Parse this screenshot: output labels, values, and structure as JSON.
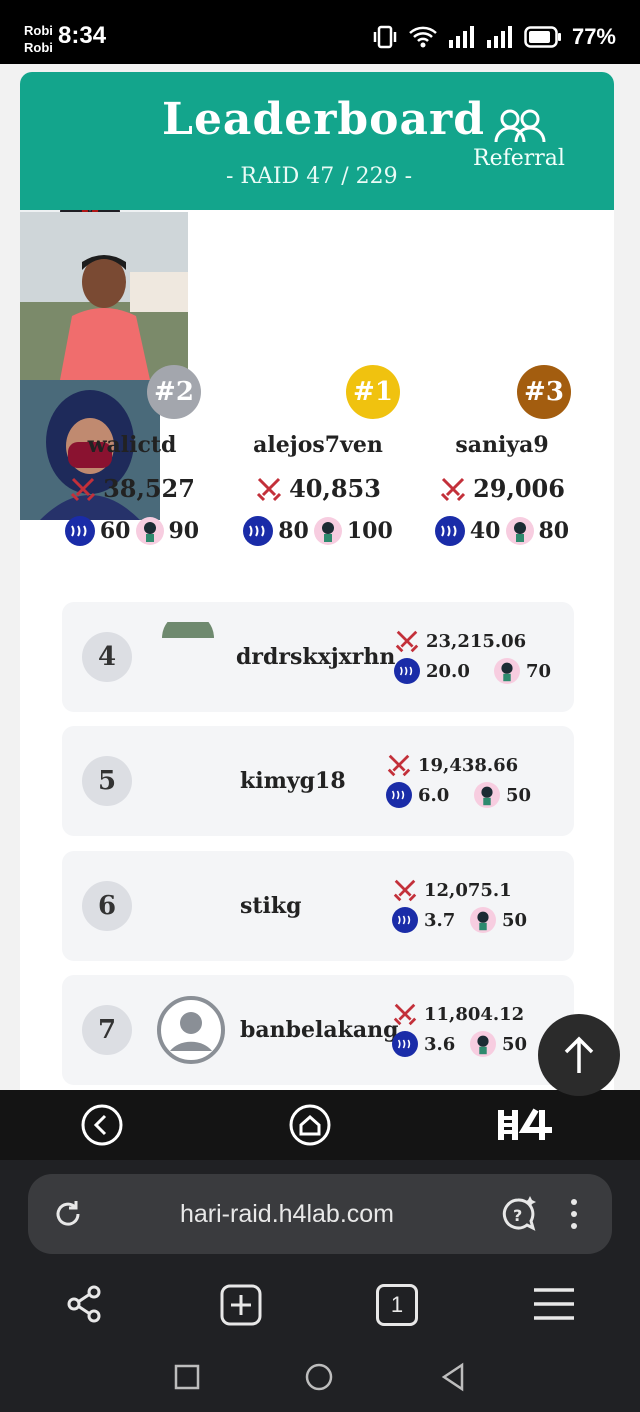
{
  "status_bar": {
    "carrier_1": "Robi",
    "carrier_2": "Robi",
    "time": "8:34",
    "battery": "77%"
  },
  "header": {
    "title": "Leaderboard",
    "subtitle": "- RAID 47 / 229 -",
    "referral_label": "Referral"
  },
  "podium": [
    {
      "rank": "#2",
      "name": "walictd",
      "score": "38,527",
      "steem": "60",
      "char": "90",
      "badge_color": "#a3a6ad"
    },
    {
      "rank": "#1",
      "name": "alejos7ven",
      "score": "40,853",
      "steem": "80",
      "char": "100",
      "badge_color": "#f0c20f"
    },
    {
      "rank": "#3",
      "name": "saniya9",
      "score": "29,006",
      "steem": "40",
      "char": "80",
      "badge_color": "#a35d0f"
    }
  ],
  "rows": [
    {
      "rank": "4",
      "name": "drdrskxjxrhn",
      "score": "23,215.06",
      "steem": "20.0",
      "char": "70"
    },
    {
      "rank": "5",
      "name": "kimyg18",
      "score": "19,438.66",
      "steem": "6.0",
      "char": "50"
    },
    {
      "rank": "6",
      "name": "stikg",
      "score": "12,075.1",
      "steem": "3.7",
      "char": "50"
    },
    {
      "rank": "7",
      "name": "banbelakang",
      "score": "11,804.12",
      "steem": "3.6",
      "char": "50"
    }
  ],
  "browser": {
    "url": "hari-raid.h4lab.com",
    "tab_count": "1"
  },
  "icons": [
    "back-icon",
    "home-icon",
    "h4-logo",
    "reload-icon",
    "assistant-icon",
    "more-icon",
    "share-icon",
    "new-tab-icon",
    "tabs-icon",
    "menu-icon",
    "scroll-top-icon",
    "swords-icon",
    "steem-icon",
    "character-icon"
  ]
}
